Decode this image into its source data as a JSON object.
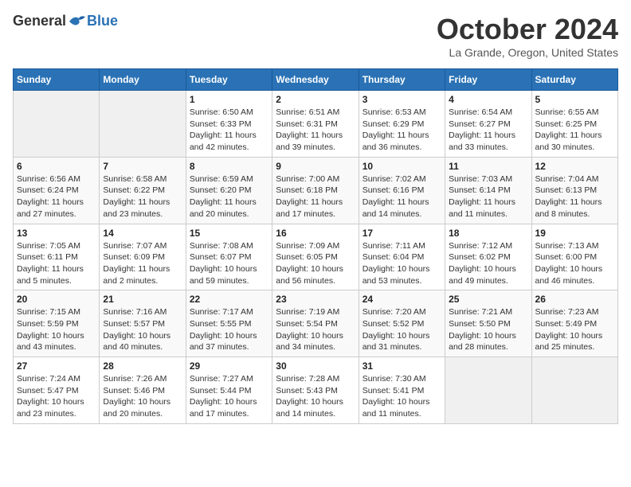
{
  "header": {
    "logo_general": "General",
    "logo_blue": "Blue",
    "month_title": "October 2024",
    "location": "La Grande, Oregon, United States"
  },
  "weekdays": [
    "Sunday",
    "Monday",
    "Tuesday",
    "Wednesday",
    "Thursday",
    "Friday",
    "Saturday"
  ],
  "weeks": [
    [
      {
        "day": "",
        "sunrise": "",
        "sunset": "",
        "daylight": ""
      },
      {
        "day": "",
        "sunrise": "",
        "sunset": "",
        "daylight": ""
      },
      {
        "day": "1",
        "sunrise": "Sunrise: 6:50 AM",
        "sunset": "Sunset: 6:33 PM",
        "daylight": "Daylight: 11 hours and 42 minutes."
      },
      {
        "day": "2",
        "sunrise": "Sunrise: 6:51 AM",
        "sunset": "Sunset: 6:31 PM",
        "daylight": "Daylight: 11 hours and 39 minutes."
      },
      {
        "day": "3",
        "sunrise": "Sunrise: 6:53 AM",
        "sunset": "Sunset: 6:29 PM",
        "daylight": "Daylight: 11 hours and 36 minutes."
      },
      {
        "day": "4",
        "sunrise": "Sunrise: 6:54 AM",
        "sunset": "Sunset: 6:27 PM",
        "daylight": "Daylight: 11 hours and 33 minutes."
      },
      {
        "day": "5",
        "sunrise": "Sunrise: 6:55 AM",
        "sunset": "Sunset: 6:25 PM",
        "daylight": "Daylight: 11 hours and 30 minutes."
      }
    ],
    [
      {
        "day": "6",
        "sunrise": "Sunrise: 6:56 AM",
        "sunset": "Sunset: 6:24 PM",
        "daylight": "Daylight: 11 hours and 27 minutes."
      },
      {
        "day": "7",
        "sunrise": "Sunrise: 6:58 AM",
        "sunset": "Sunset: 6:22 PM",
        "daylight": "Daylight: 11 hours and 23 minutes."
      },
      {
        "day": "8",
        "sunrise": "Sunrise: 6:59 AM",
        "sunset": "Sunset: 6:20 PM",
        "daylight": "Daylight: 11 hours and 20 minutes."
      },
      {
        "day": "9",
        "sunrise": "Sunrise: 7:00 AM",
        "sunset": "Sunset: 6:18 PM",
        "daylight": "Daylight: 11 hours and 17 minutes."
      },
      {
        "day": "10",
        "sunrise": "Sunrise: 7:02 AM",
        "sunset": "Sunset: 6:16 PM",
        "daylight": "Daylight: 11 hours and 14 minutes."
      },
      {
        "day": "11",
        "sunrise": "Sunrise: 7:03 AM",
        "sunset": "Sunset: 6:14 PM",
        "daylight": "Daylight: 11 hours and 11 minutes."
      },
      {
        "day": "12",
        "sunrise": "Sunrise: 7:04 AM",
        "sunset": "Sunset: 6:13 PM",
        "daylight": "Daylight: 11 hours and 8 minutes."
      }
    ],
    [
      {
        "day": "13",
        "sunrise": "Sunrise: 7:05 AM",
        "sunset": "Sunset: 6:11 PM",
        "daylight": "Daylight: 11 hours and 5 minutes."
      },
      {
        "day": "14",
        "sunrise": "Sunrise: 7:07 AM",
        "sunset": "Sunset: 6:09 PM",
        "daylight": "Daylight: 11 hours and 2 minutes."
      },
      {
        "day": "15",
        "sunrise": "Sunrise: 7:08 AM",
        "sunset": "Sunset: 6:07 PM",
        "daylight": "Daylight: 10 hours and 59 minutes."
      },
      {
        "day": "16",
        "sunrise": "Sunrise: 7:09 AM",
        "sunset": "Sunset: 6:05 PM",
        "daylight": "Daylight: 10 hours and 56 minutes."
      },
      {
        "day": "17",
        "sunrise": "Sunrise: 7:11 AM",
        "sunset": "Sunset: 6:04 PM",
        "daylight": "Daylight: 10 hours and 53 minutes."
      },
      {
        "day": "18",
        "sunrise": "Sunrise: 7:12 AM",
        "sunset": "Sunset: 6:02 PM",
        "daylight": "Daylight: 10 hours and 49 minutes."
      },
      {
        "day": "19",
        "sunrise": "Sunrise: 7:13 AM",
        "sunset": "Sunset: 6:00 PM",
        "daylight": "Daylight: 10 hours and 46 minutes."
      }
    ],
    [
      {
        "day": "20",
        "sunrise": "Sunrise: 7:15 AM",
        "sunset": "Sunset: 5:59 PM",
        "daylight": "Daylight: 10 hours and 43 minutes."
      },
      {
        "day": "21",
        "sunrise": "Sunrise: 7:16 AM",
        "sunset": "Sunset: 5:57 PM",
        "daylight": "Daylight: 10 hours and 40 minutes."
      },
      {
        "day": "22",
        "sunrise": "Sunrise: 7:17 AM",
        "sunset": "Sunset: 5:55 PM",
        "daylight": "Daylight: 10 hours and 37 minutes."
      },
      {
        "day": "23",
        "sunrise": "Sunrise: 7:19 AM",
        "sunset": "Sunset: 5:54 PM",
        "daylight": "Daylight: 10 hours and 34 minutes."
      },
      {
        "day": "24",
        "sunrise": "Sunrise: 7:20 AM",
        "sunset": "Sunset: 5:52 PM",
        "daylight": "Daylight: 10 hours and 31 minutes."
      },
      {
        "day": "25",
        "sunrise": "Sunrise: 7:21 AM",
        "sunset": "Sunset: 5:50 PM",
        "daylight": "Daylight: 10 hours and 28 minutes."
      },
      {
        "day": "26",
        "sunrise": "Sunrise: 7:23 AM",
        "sunset": "Sunset: 5:49 PM",
        "daylight": "Daylight: 10 hours and 25 minutes."
      }
    ],
    [
      {
        "day": "27",
        "sunrise": "Sunrise: 7:24 AM",
        "sunset": "Sunset: 5:47 PM",
        "daylight": "Daylight: 10 hours and 23 minutes."
      },
      {
        "day": "28",
        "sunrise": "Sunrise: 7:26 AM",
        "sunset": "Sunset: 5:46 PM",
        "daylight": "Daylight: 10 hours and 20 minutes."
      },
      {
        "day": "29",
        "sunrise": "Sunrise: 7:27 AM",
        "sunset": "Sunset: 5:44 PM",
        "daylight": "Daylight: 10 hours and 17 minutes."
      },
      {
        "day": "30",
        "sunrise": "Sunrise: 7:28 AM",
        "sunset": "Sunset: 5:43 PM",
        "daylight": "Daylight: 10 hours and 14 minutes."
      },
      {
        "day": "31",
        "sunrise": "Sunrise: 7:30 AM",
        "sunset": "Sunset: 5:41 PM",
        "daylight": "Daylight: 10 hours and 11 minutes."
      },
      {
        "day": "",
        "sunrise": "",
        "sunset": "",
        "daylight": ""
      },
      {
        "day": "",
        "sunrise": "",
        "sunset": "",
        "daylight": ""
      }
    ]
  ]
}
